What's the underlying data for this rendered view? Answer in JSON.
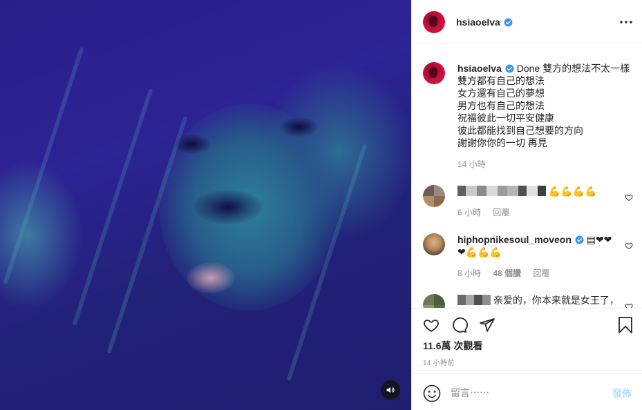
{
  "post": {
    "username": "hsiaoelva",
    "caption_lines": [
      "Done 雙方的想法不太一樣",
      "雙方都有自己的想法",
      "女方還有自己的夢想",
      "男方也有自己的想法",
      "祝福彼此一切平安健康",
      "彼此都能找到自己想要的方向",
      "謝謝你你的一切 再見"
    ],
    "caption_time": "14 小時"
  },
  "comments": [
    {
      "text": "💪💪💪💪",
      "time": "6 小時",
      "reply_label": "回覆"
    },
    {
      "username": "hiphopnikesoul_moveon",
      "text_line1": "▤❤❤",
      "text_line2": "❤💪💪💪",
      "time": "8 小時",
      "likes": "48 個讚",
      "reply_label": "回覆"
    },
    {
      "text": "亲爱的，你本来就是女王了，"
    }
  ],
  "stats": {
    "views": "11.6萬 次觀看",
    "posted": "14 小時前"
  },
  "add_comment": {
    "placeholder": "留言⋯⋯",
    "post_label": "發佈"
  },
  "colors": {
    "verified": "#3897f0",
    "post_disabled": "#b2dffc",
    "meta": "#8e8e8e"
  },
  "icons": [
    "volume-icon",
    "more-icon",
    "verified-icon",
    "heart-icon",
    "comment-icon",
    "share-icon",
    "bookmark-icon",
    "emoji-icon"
  ]
}
